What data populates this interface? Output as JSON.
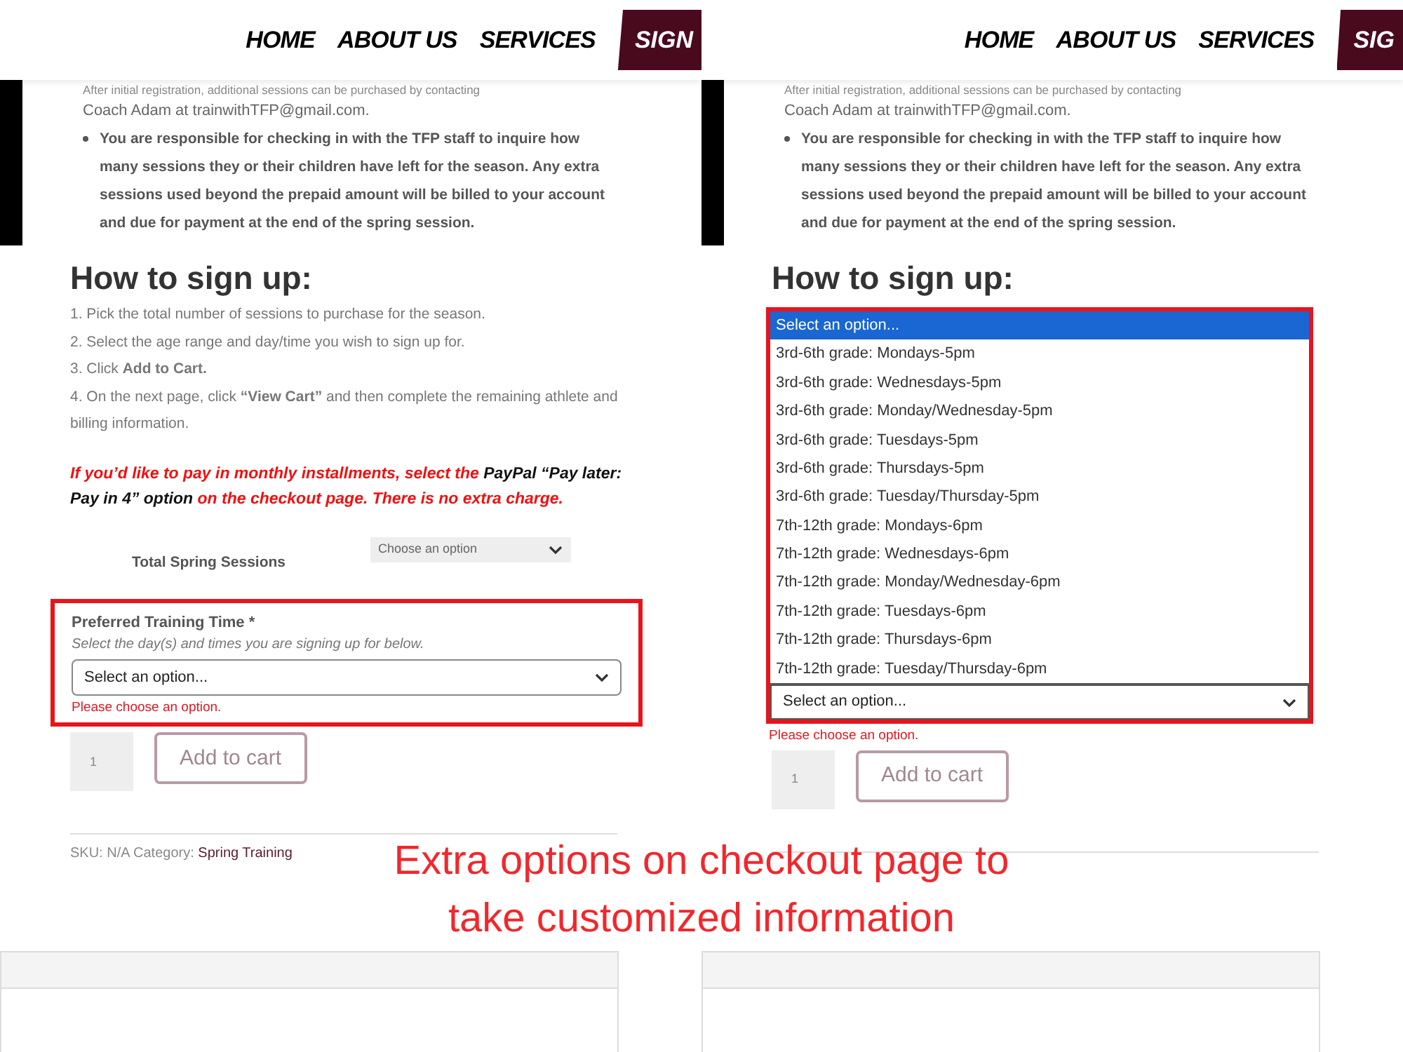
{
  "panels": [
    {
      "nav": [
        "HOME",
        "ABOUT US",
        "SERVICES"
      ],
      "nav_button": "SIGN",
      "intro": {
        "line": "After initial registration, additional sessions can be purchased by contacting",
        "email_line": "Coach Adam at trainwithTFP@gmail.com.",
        "bullet": "You are responsible for checking in with the TFP staff to inquire how many sessions they or their children have left for the season. Any extra sessions used beyond the prepaid amount will be billed to your account and due for payment at the end of the spring session."
      },
      "heading": "How to sign up:",
      "steps": [
        "1. Pick the total number of sessions to purchase for the season.",
        "2. Select the age range and day/time you wish to sign up for.",
        "3. Click **Add to Cart.**",
        "4. On the next page, click **“View Cart”** and then complete the remaining athlete and billing information."
      ],
      "note": [
        {
          "kind": "highlight",
          "text": "If you’d like to pay in monthly installments, select the"
        },
        {
          "kind": "plain",
          "text": "PayPal “Pay later: Pay in 4” option"
        },
        {
          "kind": "highlight",
          "text": "on the checkout page. There is no extra charge."
        }
      ],
      "total": {
        "label": "Total Spring Sessions",
        "select": "Choose an option"
      },
      "field": {
        "label": "Preferred Training Time *",
        "hint": "Select the day(s) and times you are signing up for below.",
        "value": "Select an option...",
        "expanded": false,
        "error": "Please choose an option."
      },
      "quantity": "1",
      "add_button": "Add to cart",
      "meta": {
        "sku": "SKU: N/A Category:",
        "category": "Spring Training"
      }
    },
    {
      "nav": [
        "HOME",
        "ABOUT US",
        "SERVICES"
      ],
      "nav_button": "SIG",
      "intro": {
        "line": "After initial registration, additional sessions can be purchased by contacting",
        "email_line": "Coach Adam at trainwithTFP@gmail.com.",
        "bullet": "You are responsible for checking in with the TFP staff to inquire how many sessions they or their children have left for the season. Any extra sessions used beyond the prepaid amount will be billed to your account and due for payment at the end of the spring session."
      },
      "heading": "How to sign up:",
      "field": {
        "value": "Select an option...",
        "expanded": true,
        "error": "Please choose an option.",
        "options": [
          {
            "label": "Select an option...",
            "selected": true
          },
          {
            "label": "3rd-6th grade: Mondays-5pm",
            "selected": false
          },
          {
            "label": "3rd-6th grade: Wednesdays-5pm",
            "selected": false
          },
          {
            "label": "3rd-6th grade: Monday/Wednesday-5pm",
            "selected": false
          },
          {
            "label": "3rd-6th grade: Tuesdays-5pm",
            "selected": false
          },
          {
            "label": "3rd-6th grade: Thursdays-5pm",
            "selected": false
          },
          {
            "label": "3rd-6th grade: Tuesday/Thursday-5pm",
            "selected": false
          },
          {
            "label": "7th-12th grade: Mondays-6pm",
            "selected": false
          },
          {
            "label": "7th-12th grade: Wednesdays-6pm",
            "selected": false
          },
          {
            "label": "7th-12th grade: Monday/Wednesday-6pm",
            "selected": false
          },
          {
            "label": "7th-12th grade: Tuesdays-6pm",
            "selected": false
          },
          {
            "label": "7th-12th grade: Thursdays-6pm",
            "selected": false
          },
          {
            "label": "7th-12th grade: Tuesday/Thursday-6pm",
            "selected": false
          }
        ]
      },
      "quantity": "1",
      "add_button": "Add to cart"
    }
  ],
  "caption": [
    "Extra options on checkout page to",
    "take customized information"
  ]
}
